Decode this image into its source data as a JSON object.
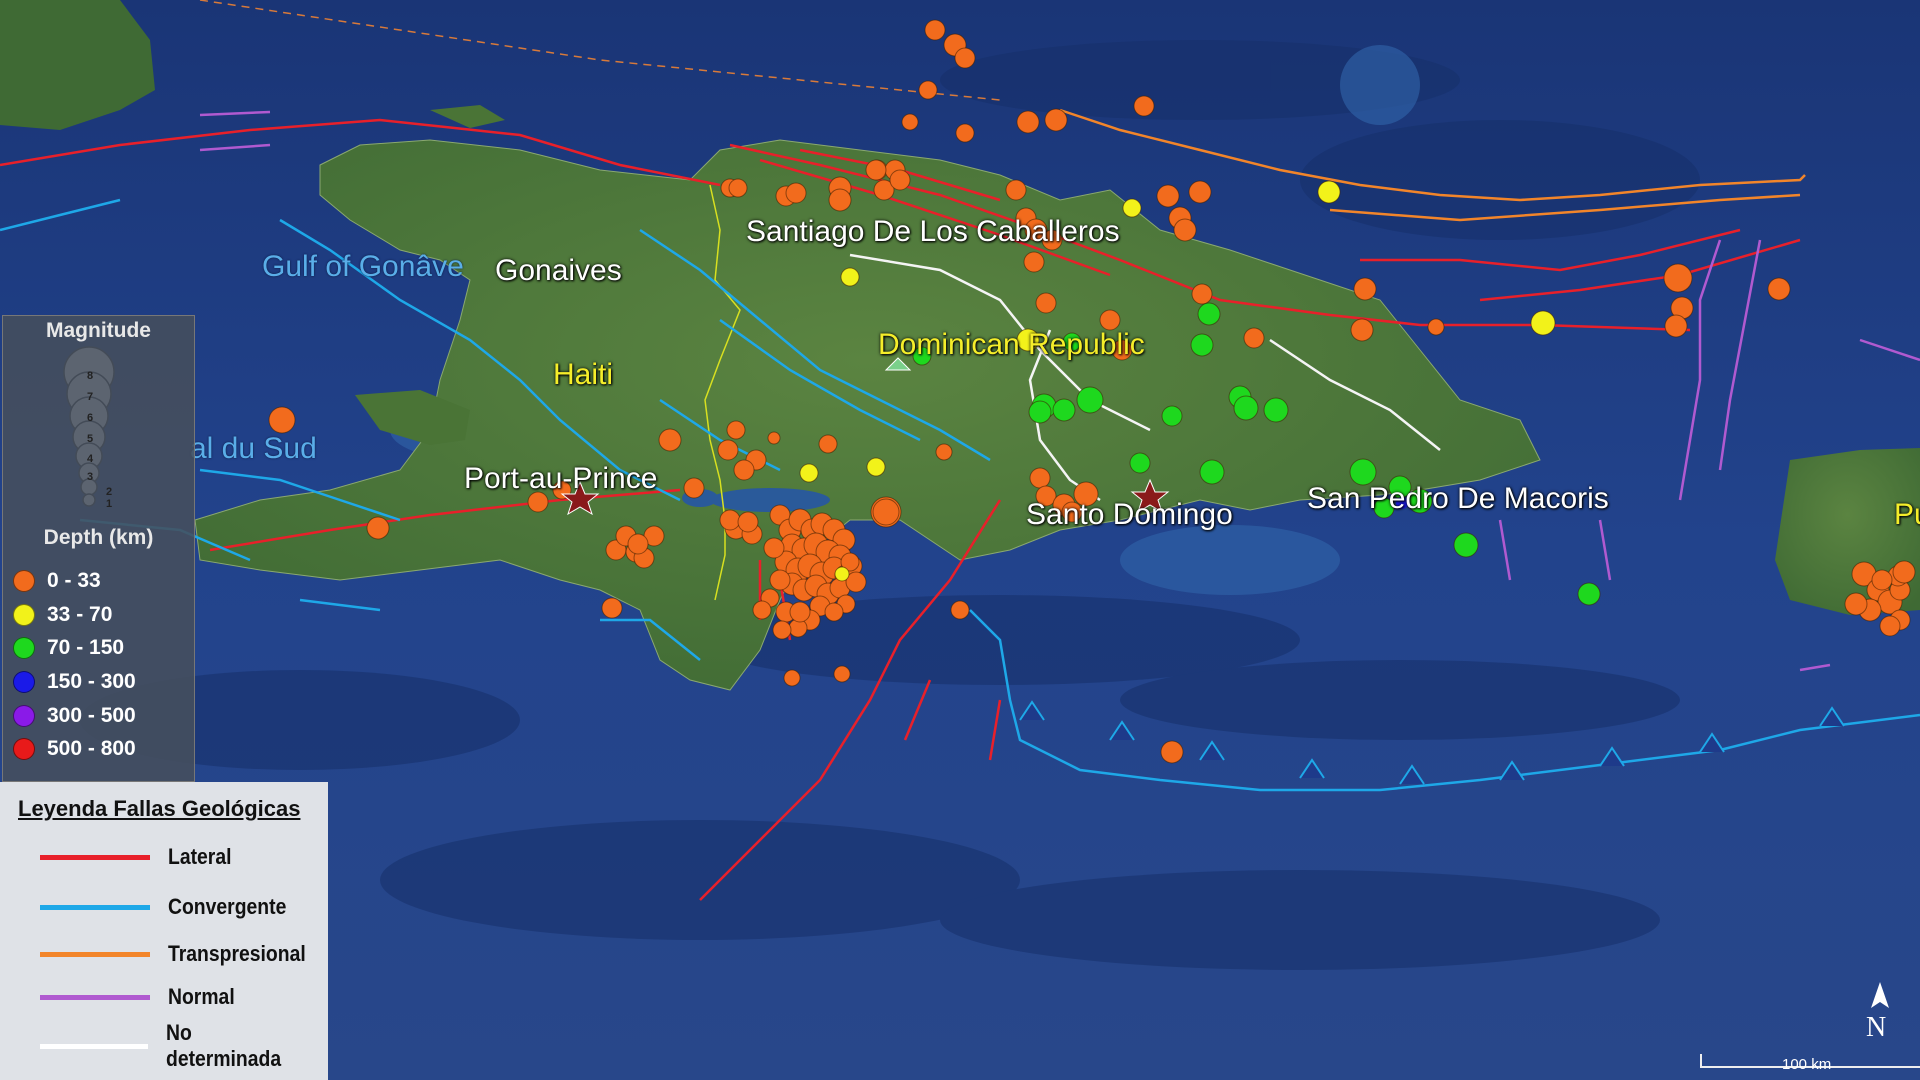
{
  "labels": {
    "santiago": "Santiago De Los Caballeros",
    "gonaives": "Gonaives",
    "gulf": "Gulf of Gonâve",
    "haiti": "Haiti",
    "dominican": "Dominican Republic",
    "canal": "al du Sud",
    "port_au_prince": "Port-au-Prince",
    "santo_domingo": "Santo Domingo",
    "san_pedro": "San Pedro De Macoris",
    "puerto_rico": "Pu"
  },
  "magnitude_legend": {
    "title": "Magnitude",
    "levels": [
      "8",
      "7",
      "6",
      "5",
      "4",
      "3",
      "2",
      "1"
    ]
  },
  "depth_legend": {
    "title": "Depth (km)",
    "items": [
      {
        "label": "0 - 33",
        "color": "#f26b1d"
      },
      {
        "label": "33 - 70",
        "color": "#f2f21a"
      },
      {
        "label": "70 - 150",
        "color": "#1ed81e"
      },
      {
        "label": "150 - 300",
        "color": "#1a1ae8"
      },
      {
        "label": "300 - 500",
        "color": "#8a1ae8"
      },
      {
        "label": "500 - 800",
        "color": "#e81a1a"
      }
    ]
  },
  "fault_legend": {
    "title": "Leyenda Fallas Geológicas",
    "items": [
      {
        "label": "Lateral",
        "color": "#e8202a"
      },
      {
        "label": "Convergente",
        "color": "#1ea8e8"
      },
      {
        "label": "Transpresional",
        "color": "#f2852a"
      },
      {
        "label": "Normal",
        "color": "#b05ad0"
      },
      {
        "label": "No determinada",
        "color": "#ffffff"
      }
    ]
  },
  "north_label": "N",
  "scale_label": "100 km",
  "colors": {
    "ocean": "#1f3d82",
    "land": "#4e7a3a",
    "shallow": "#f26b1d",
    "intermediate": "#f2f21a",
    "deep": "#1ed81e"
  }
}
